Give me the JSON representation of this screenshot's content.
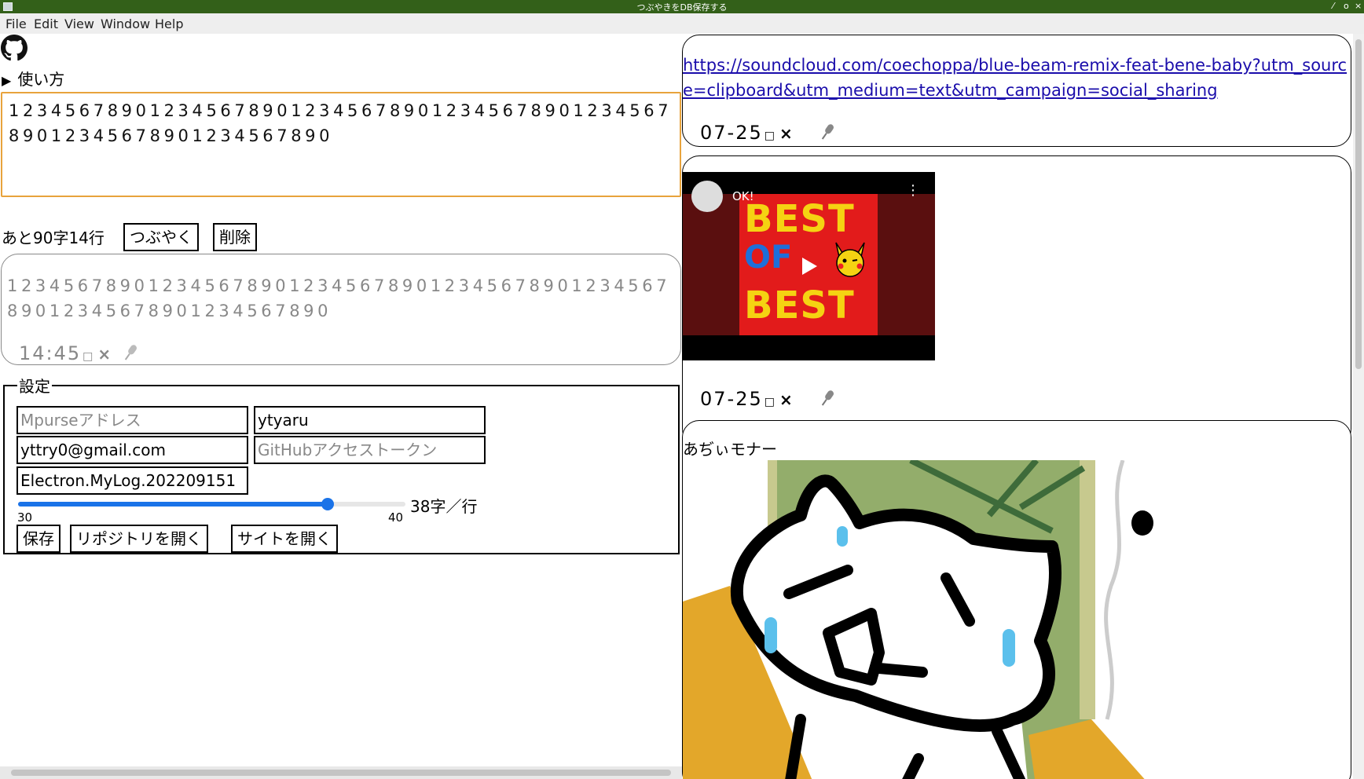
{
  "window": {
    "title": "つぶやきをDB保存する",
    "controls": [
      "⁄",
      "o",
      "×"
    ]
  },
  "menu": [
    "File",
    "Edit",
    "View",
    "Window",
    "Help"
  ],
  "usage_label": "使い方",
  "composer": {
    "text": "1234567890123456789012345678901234567890123456789012345678901234567890",
    "counter": "あと90字14行",
    "post_label": "つぶやく",
    "delete_label": "削除"
  },
  "preview": {
    "text": "1234567890123456789012345678901234567890123456789012345678901234567890",
    "time": "14:45",
    "checkbox": "□",
    "delete": "×"
  },
  "settings": {
    "legend": "設定",
    "mpurse_placeholder": "Mpurseアドレス",
    "username_value": "ytyaru",
    "email_value": "yttry0@gmail.com",
    "token_placeholder": "GitHubアクセストークン",
    "repo_value": "Electron.MyLog.202209151",
    "slider": {
      "min": "30",
      "max": "40",
      "value": 38,
      "label": "38字／行"
    },
    "save_label": "保存",
    "open_repo_label": "リポジトリを開く",
    "open_site_label": "サイトを開く"
  },
  "posts": [
    {
      "link": "https://soundcloud.com/coechoppa/blue-beam-remix-feat-bene-baby?utm_source=clipboard&utm_medium=text&utm_campaign=social_sharing",
      "date": "07-25",
      "checkbox": "□",
      "delete": "×"
    },
    {
      "video": {
        "channel_title": "OK!",
        "thumb_top": "BEST",
        "thumb_mid": "OF",
        "thumb_bottom": "BEST"
      },
      "date": "07-25",
      "checkbox": "□",
      "delete": "×"
    },
    {
      "text": "あぢぃモナー"
    }
  ],
  "colors": {
    "titlebar": "#336019",
    "accent": "#1a73e8",
    "focus_border": "#e8a33c",
    "link": "#1a0dab"
  }
}
